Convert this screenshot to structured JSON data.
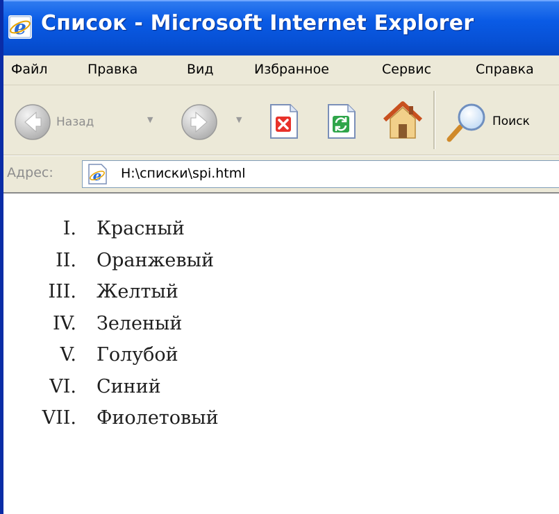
{
  "window": {
    "title": "Список - Microsoft Internet Explorer"
  },
  "menubar": {
    "items": [
      "Файл",
      "Правка",
      "Вид",
      "Избранное",
      "Сервис",
      "Справка"
    ]
  },
  "toolbar": {
    "back_label": "Назад",
    "search_label": "Поиск"
  },
  "address": {
    "label": "Адрес:",
    "value": "H:\\списки\\spi.html"
  },
  "page": {
    "list": [
      {
        "marker": "I.",
        "label": "Красный"
      },
      {
        "marker": "II.",
        "label": "Оранжевый"
      },
      {
        "marker": "III.",
        "label": "Желтый"
      },
      {
        "marker": "IV.",
        "label": "Зеленый"
      },
      {
        "marker": "V.",
        "label": "Голубой"
      },
      {
        "marker": "VI.",
        "label": "Синий"
      },
      {
        "marker": "VII.",
        "label": "Фиолетовый"
      }
    ]
  },
  "colors": {
    "desktop_blue": "#0A2CA6",
    "titlebar_blue": "#0A5BE5",
    "chrome_beige": "#ECE9D8"
  }
}
